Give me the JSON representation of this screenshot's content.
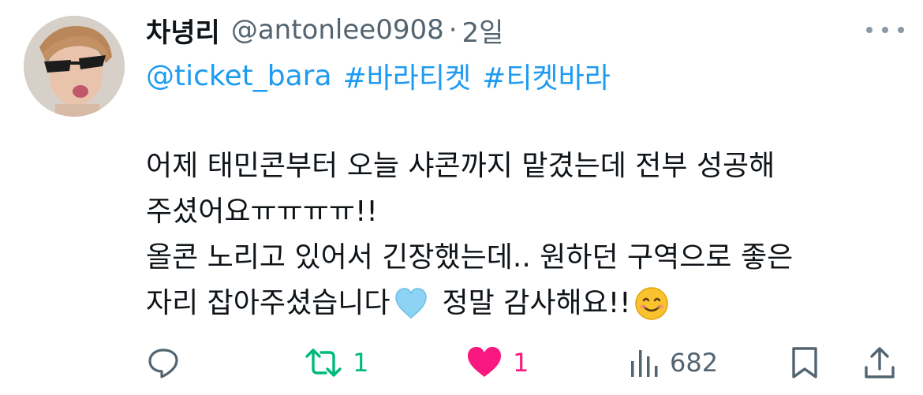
{
  "author": {
    "name": "차녕리",
    "handle": "@antonlee0908",
    "separator": "·",
    "time": "2일"
  },
  "mentions": [
    "@ticket_bara",
    "#바라티켓",
    "#티켓바라"
  ],
  "body": {
    "line1": "어제 태민콘부터 오늘 샤콘까지 맡겼는데 전부 성공해",
    "line2": "주셨어요ㅠㅠㅠㅠ!!",
    "line3": "올콘 노리고 있어서 긴장했는데.. 원하던 구역으로 좋은",
    "line4_a": "자리 잡아주셨습니다",
    "line4_b": "정말 감사해요!!"
  },
  "icons": {
    "avatar": "profile-photo",
    "more": "more-options-icon",
    "heart_emoji": "light-blue-heart-emoji",
    "smile_emoji": "smiling-face-emoji",
    "reply": "reply-icon",
    "retweet": "retweet-icon",
    "like": "heart-icon",
    "views": "views-chart-icon",
    "bookmark": "bookmark-icon",
    "share": "share-icon"
  },
  "actions": {
    "reply_count": "",
    "retweet_count": "1",
    "like_count": "1",
    "views_count": "682"
  },
  "colors": {
    "link": "#1d9bf0",
    "retweet_active": "#00ba7c",
    "like_active": "#f91880",
    "secondary": "#536471"
  }
}
